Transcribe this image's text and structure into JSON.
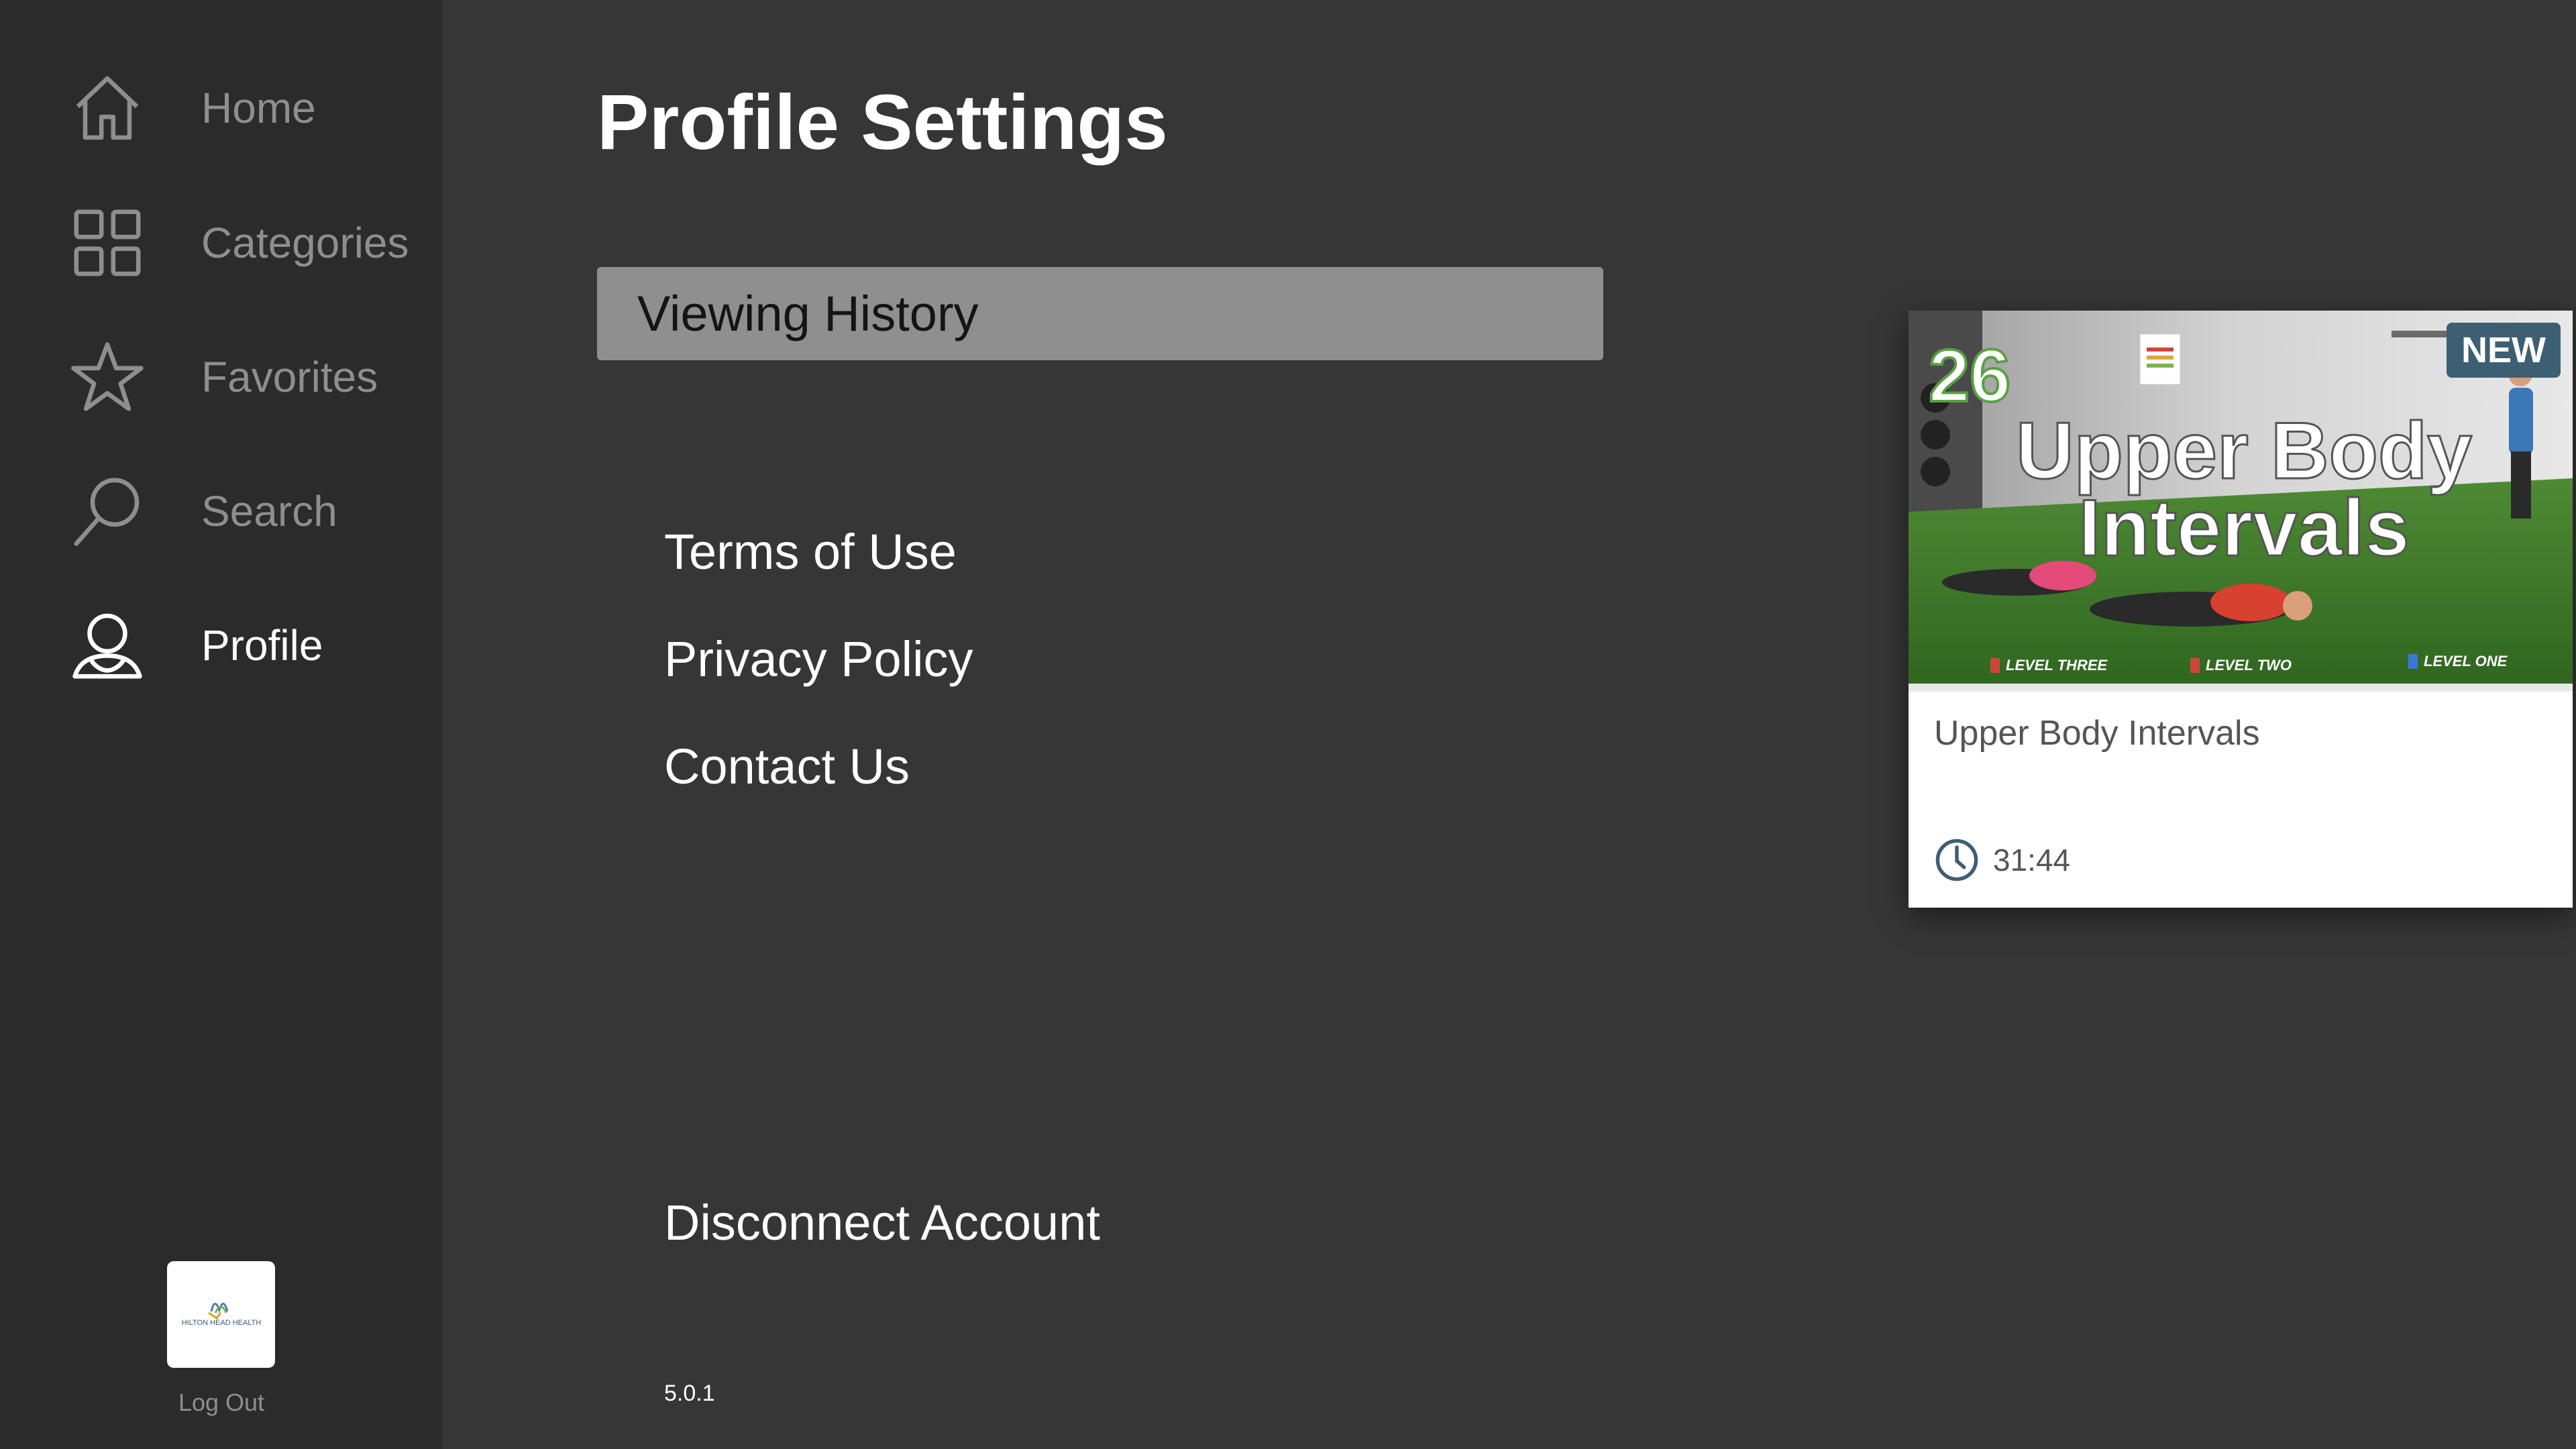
{
  "sidebar": {
    "items": [
      {
        "label": "Home",
        "icon": "home-icon"
      },
      {
        "label": "Categories",
        "icon": "grid-icon"
      },
      {
        "label": "Favorites",
        "icon": "star-icon"
      },
      {
        "label": "Search",
        "icon": "search-icon"
      },
      {
        "label": "Profile",
        "icon": "profile-icon",
        "active": true
      }
    ],
    "logo_text": "HILTON HEAD HEALTH",
    "logout_label": "Log Out"
  },
  "main": {
    "title": "Profile Settings",
    "viewing_history_label": "Viewing History",
    "links": [
      "Terms of Use",
      "Privacy Policy",
      "Contact Us"
    ],
    "disconnect_label": "Disconnect Account",
    "version": "5.0.1"
  },
  "card": {
    "badge": "NEW",
    "thumb_number": "26",
    "thumb_title_line1": "Upper Body",
    "thumb_title_line2": "Intervals",
    "levels": [
      "LEVEL THREE",
      "LEVEL TWO",
      "LEVEL ONE"
    ],
    "title": "Upper Body Intervals",
    "duration": "31:44"
  },
  "colors": {
    "background": "#363636",
    "sidebar": "#2b2b2b",
    "inactive_text": "#8e8e8e",
    "active_text": "#ffffff",
    "badge": "#3d5f73",
    "turf": "#3f7a2c"
  }
}
